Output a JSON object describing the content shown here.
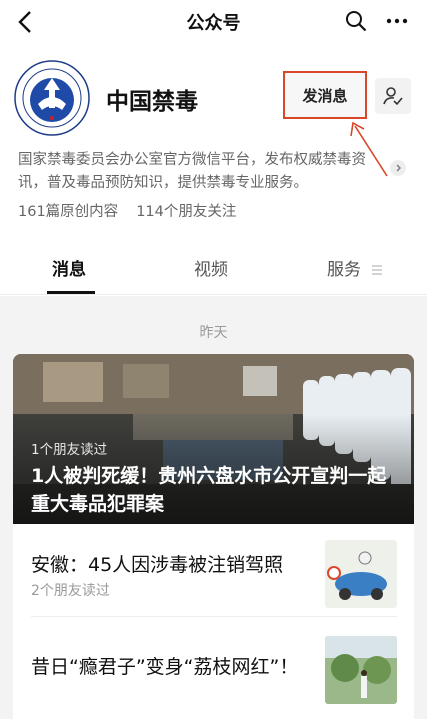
{
  "header": {
    "title": "公众号",
    "back_icon": "chevron-left-icon",
    "search_icon": "search-icon",
    "more_icon": "more-dots-icon"
  },
  "account": {
    "name": "中国禁毒",
    "avatar_icon": "national-narcotics-control-emblem",
    "send_message_label": "发消息",
    "follow_icon": "person-check-icon",
    "description": "国家禁毒委员会办公室官方微信平台，发布权威禁毒资讯，普及毒品预防知识，提供禁毒专业服务。",
    "original_count": "161篇原创内容",
    "friends_following": "114个朋友关注",
    "accent_color": "#d9472b"
  },
  "tabs": [
    {
      "label": "消息",
      "active": true
    },
    {
      "label": "视频",
      "active": false
    },
    {
      "label": "服务",
      "active": false
    }
  ],
  "feed": {
    "date_label": "昨天",
    "featured": {
      "readers": "1个朋友读过",
      "title": "1人被判死缓！贵州六盘水市公开宣判一起重大毒品犯罪案"
    },
    "items": [
      {
        "title": "安徽：45人因涉毒被注销驾照",
        "sub": "2个朋友读过"
      },
      {
        "title": "昔日“瘾君子”变身“荔枝网红”！",
        "sub": ""
      }
    ]
  }
}
